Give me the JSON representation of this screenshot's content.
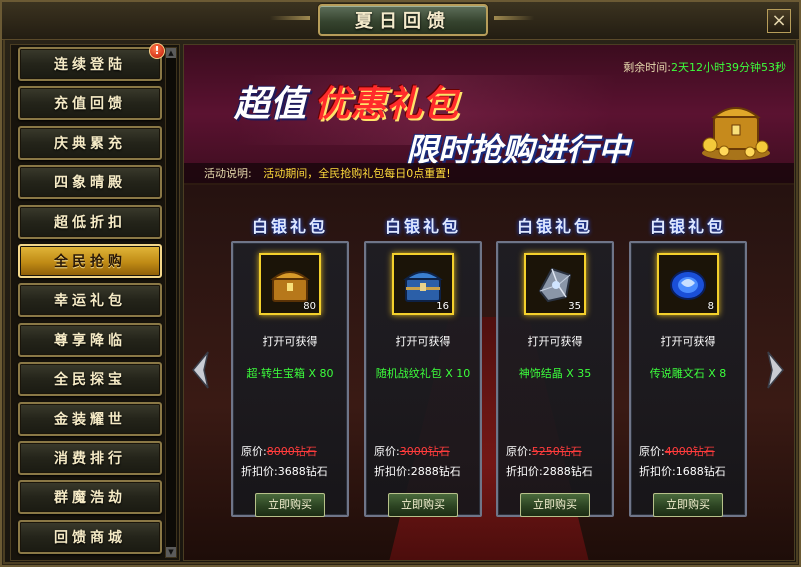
{
  "window": {
    "title": "夏日回馈",
    "close_label": "×"
  },
  "sidebar": {
    "items": [
      {
        "label": "连续登陆",
        "active": false,
        "badge": "!"
      },
      {
        "label": "充值回馈",
        "active": false
      },
      {
        "label": "庆典累充",
        "active": false
      },
      {
        "label": "四象晴殿",
        "active": false
      },
      {
        "label": "超低折扣",
        "active": false
      },
      {
        "label": "全民抢购",
        "active": true
      },
      {
        "label": "幸运礼包",
        "active": false
      },
      {
        "label": "尊享降临",
        "active": false
      },
      {
        "label": "全民探宝",
        "active": false
      },
      {
        "label": "金装耀世",
        "active": false
      },
      {
        "label": "消费排行",
        "active": false
      },
      {
        "label": "群魔浩劫",
        "active": false
      },
      {
        "label": "回馈商城",
        "active": false
      }
    ],
    "scroll_up": "▲",
    "scroll_down": "▼"
  },
  "banner": {
    "countdown_label": "剩余时间:",
    "countdown_value": "2天12小时39分钟53秒",
    "line1_prefix": "超值",
    "line1_highlight": "优惠礼包",
    "line2": "限时抢购进行中",
    "notice_label": "活动说明:",
    "notice_text": "活动期间，全民抢购礼包每日0点重置!"
  },
  "packs": [
    {
      "title": "白银礼包",
      "icon": "golden-chest-icon",
      "count": "80",
      "open_label": "打开可获得",
      "reward": "超·转生宝箱 X 80",
      "orig_label": "原价:",
      "orig_price": "8000钻石",
      "disc_label": "折扣价:",
      "disc_price": "3688钻石",
      "buy_label": "立即购买"
    },
    {
      "title": "白银礼包",
      "icon": "blue-chest-icon",
      "count": "16",
      "open_label": "打开可获得",
      "reward": "随机战纹礼包 X 10",
      "orig_label": "原价:",
      "orig_price": "3000钻石",
      "disc_label": "折扣价:",
      "disc_price": "2888钻石",
      "buy_label": "立即购买"
    },
    {
      "title": "白银礼包",
      "icon": "crystal-icon",
      "count": "35",
      "open_label": "打开可获得",
      "reward": "神饰结晶 X 35",
      "orig_label": "原价:",
      "orig_price": "5250钻石",
      "disc_label": "折扣价:",
      "disc_price": "2888钻石",
      "buy_label": "立即购买"
    },
    {
      "title": "白银礼包",
      "icon": "rune-stone-icon",
      "count": "8",
      "open_label": "打开可获得",
      "reward": "传说雕文石 X 8",
      "orig_label": "原价:",
      "orig_price": "4000钻石",
      "disc_label": "折扣价:",
      "disc_price": "1688钻石",
      "buy_label": "立即购买"
    }
  ],
  "colors": {
    "accent_gold": "#f4d02c",
    "reward_green": "#3cff3c",
    "price_red": "#ff3c3c",
    "notice_yellow": "#ffdc3c"
  }
}
